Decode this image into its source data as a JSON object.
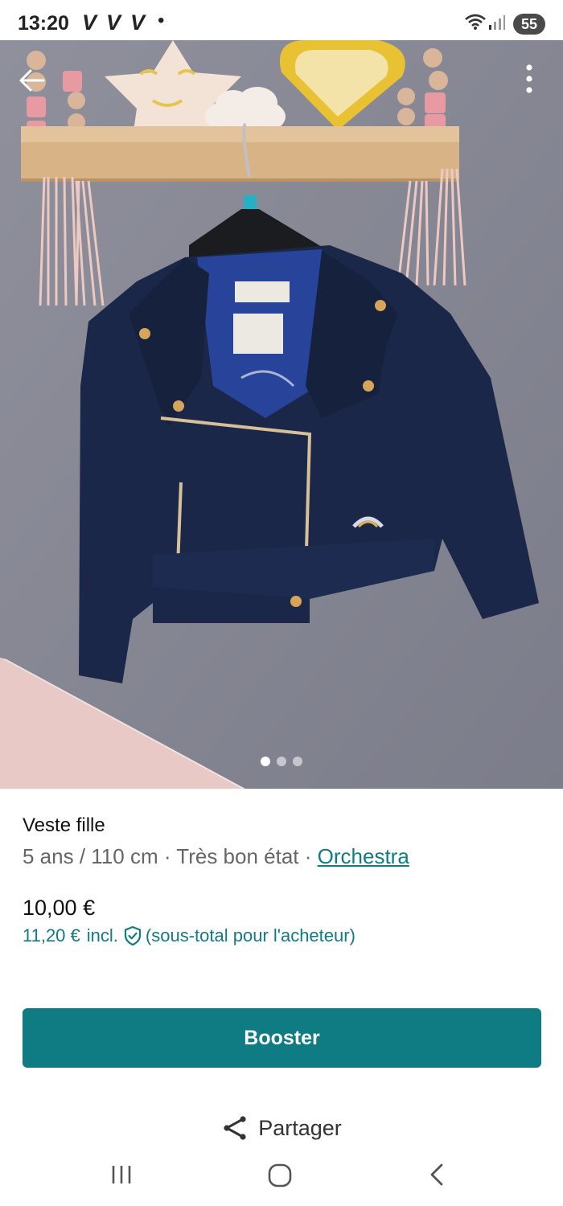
{
  "status_bar": {
    "time": "13:20",
    "notification_icons": [
      "V",
      "V",
      "V"
    ],
    "dot": "•",
    "wifi_icon": "wifi-icon",
    "signal_icon": "signal-icon",
    "battery": "55"
  },
  "photo": {
    "image_count": 3,
    "active_index": 0,
    "back_icon": "arrow-left-icon",
    "more_icon": "more-vertical-icon"
  },
  "product": {
    "title": "Veste fille",
    "size": "5 ans / 110 cm",
    "separator": "·",
    "condition": "Très bon état",
    "brand": "Orchestra",
    "price": "10,00 €",
    "buyer_price": "11,20 €",
    "buyer_price_incl": "incl.",
    "buyer_price_note": "(sous-total pour l'acheteur)"
  },
  "actions": {
    "booster_label": "Booster",
    "share_label": "Partager"
  },
  "nav": {
    "recents_icon": "recent-apps-icon",
    "home_icon": "home-icon",
    "back_icon": "nav-back-icon"
  },
  "colors": {
    "accent": "#0e7c82",
    "booster_bg": "#0e7c82",
    "muted_text": "#666666"
  }
}
